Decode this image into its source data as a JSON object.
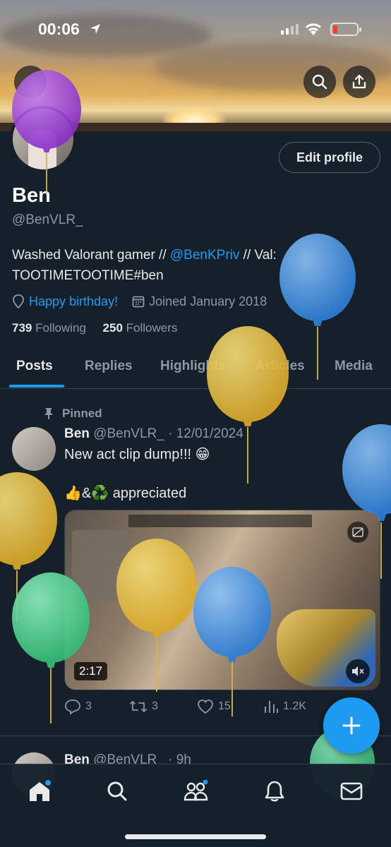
{
  "status_bar": {
    "time": "00:06"
  },
  "profile": {
    "name": "Ben",
    "handle": "@BenVLR_",
    "edit_button": "Edit profile",
    "bio_prefix": "Washed Valorant gamer // ",
    "bio_mention": "@BenKPriv",
    "bio_suffix": " // Val: TOOTIMETOOTIME#ben",
    "birthday": "Happy birthday!",
    "joined": "Joined January 2018",
    "following_count": "739",
    "following_label": "Following",
    "followers_count": "250",
    "followers_label": "Followers"
  },
  "tabs": [
    {
      "label": "Posts",
      "active": true
    },
    {
      "label": "Replies"
    },
    {
      "label": "Highlights"
    },
    {
      "label": "Articles"
    },
    {
      "label": "Media"
    }
  ],
  "pinned_post": {
    "pinned_label": "Pinned",
    "author": "Ben",
    "handle": "@BenVLR_",
    "date": "· 12/01/2024",
    "text": "New act clip dump!!! 😁",
    "text2": "👍&♻️ appreciated",
    "video_duration": "2:17",
    "replies": "3",
    "reposts": "3",
    "likes": "15",
    "views": "1.2K"
  },
  "second_post": {
    "author": "Ben",
    "handle": "@BenVLR_",
    "time": "· 9h"
  },
  "icons": {
    "location": "location-pin-icon",
    "calendar": "calendar-icon",
    "search": "search-icon",
    "share": "share-icon",
    "pin": "pin-icon"
  },
  "colors": {
    "background": "#15202b",
    "accent": "#1d9bf0",
    "muted": "#8b98a5",
    "balloon_purple": "#9b3fd6",
    "balloon_blue": "#3d8ee0",
    "balloon_yellow": "#e6bf36",
    "balloon_green": "#4fd08f"
  }
}
